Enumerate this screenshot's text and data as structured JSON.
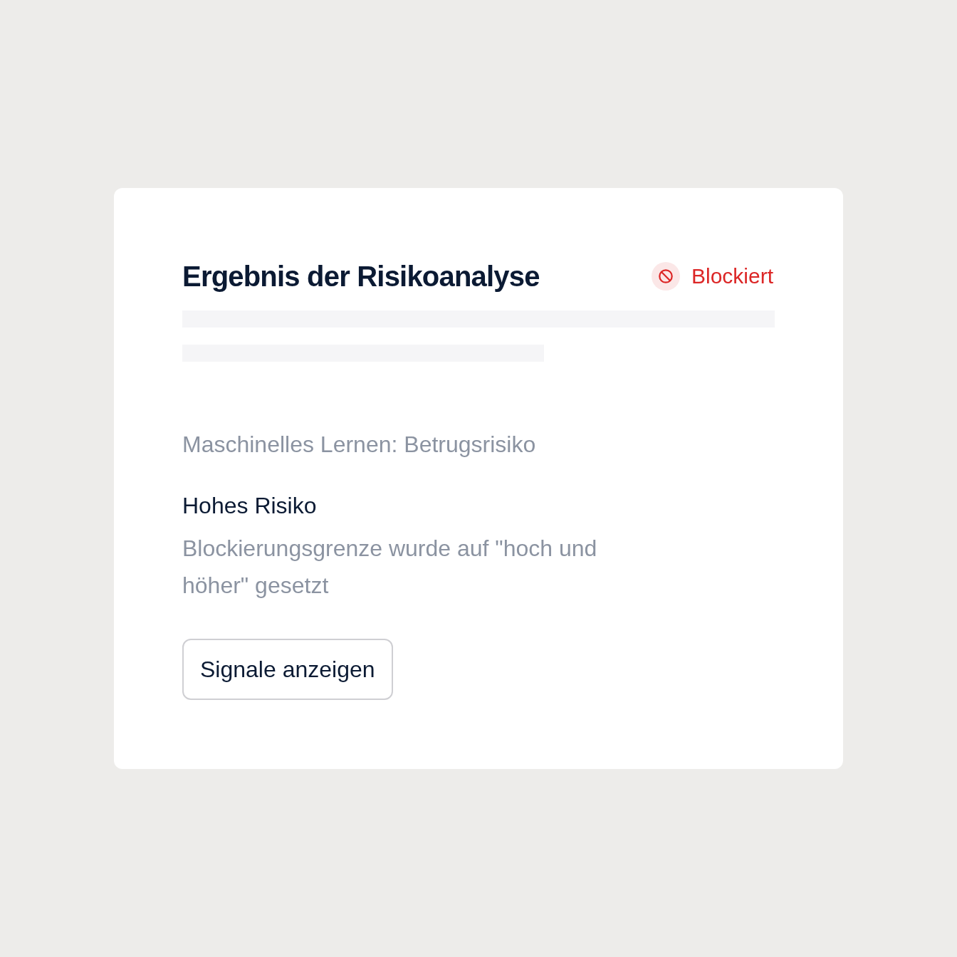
{
  "card": {
    "title": "Ergebnis der Risikoanalyse",
    "status": {
      "kind": "blocked",
      "label": "Blockiert"
    },
    "model": "Maschinelles Lernen: Betrugsrisiko",
    "risk": {
      "label": "Hohes Risiko",
      "description": "Blockierungsgrenze wurde auf \"hoch und höher\" gesetzt"
    },
    "buttons": [
      {
        "label": "Signale anzeigen"
      }
    ]
  }
}
